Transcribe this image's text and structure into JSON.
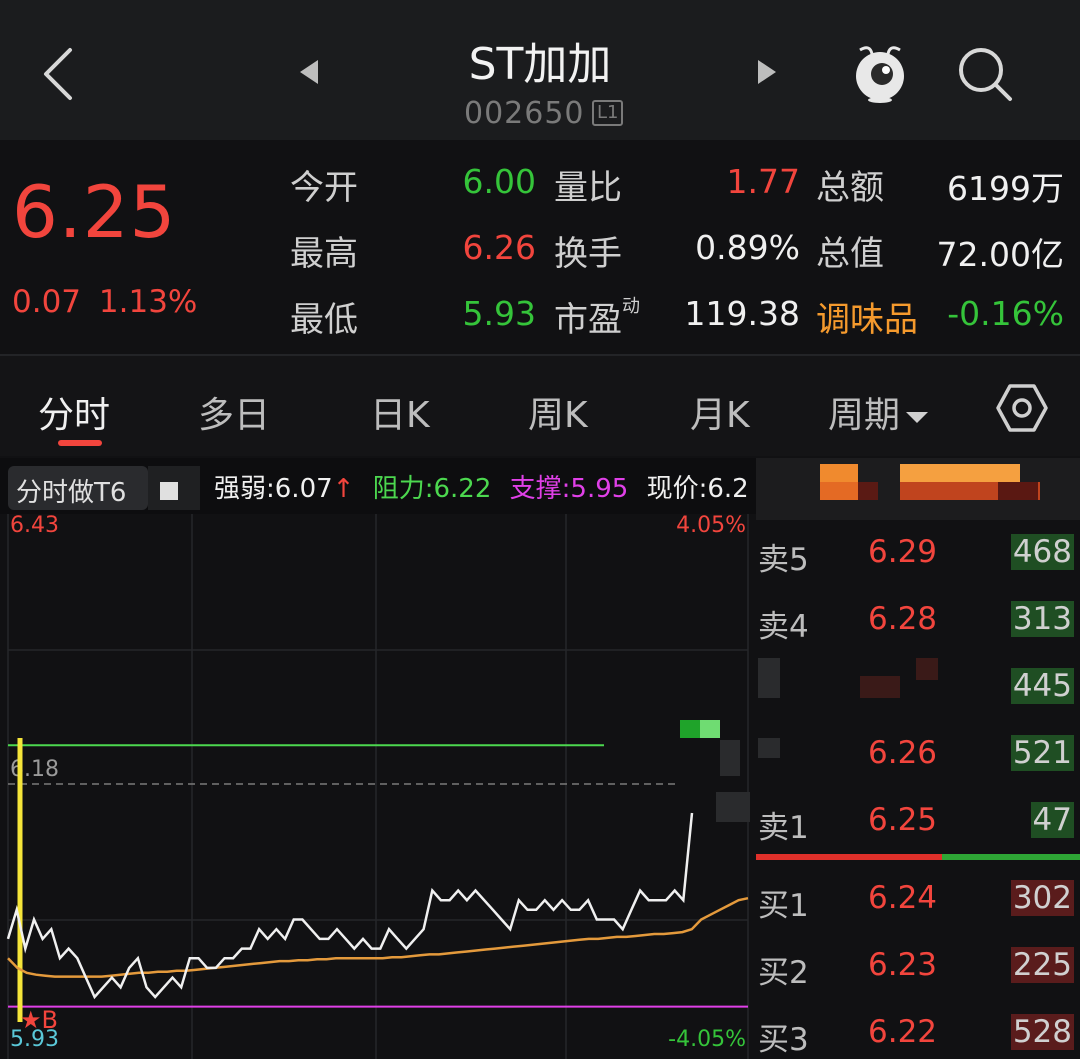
{
  "header": {
    "title": "ST加加",
    "code": "002650",
    "level_badge": "L1"
  },
  "quote": {
    "price": "6.25",
    "change": "0.07",
    "change_pct": "1.13%",
    "stats": [
      {
        "label": "今开",
        "value": "6.00",
        "color": "#35c43a"
      },
      {
        "label": "量比",
        "value": "1.77",
        "color": "#f2453d"
      },
      {
        "label": "总额",
        "value": "6199万",
        "color": "#f0f0f0"
      },
      {
        "label": "最高",
        "value": "6.26",
        "color": "#f2453d"
      },
      {
        "label": "换手",
        "value": "0.89%",
        "color": "#f0f0f0"
      },
      {
        "label": "总值",
        "value": "72.00亿",
        "color": "#f0f0f0"
      },
      {
        "label": "最低",
        "value": "5.93",
        "color": "#35c43a"
      },
      {
        "label": "市盈",
        "label_sup": "动",
        "value": "119.38",
        "color": "#f0f0f0"
      },
      {
        "label": "调味品",
        "value": "-0.16%",
        "color": "#35c43a"
      }
    ]
  },
  "tabs": [
    {
      "label": "分时",
      "active": true
    },
    {
      "label": "多日"
    },
    {
      "label": "日K"
    },
    {
      "label": "周K"
    },
    {
      "label": "月K"
    },
    {
      "label": "周期"
    }
  ],
  "indicator": {
    "tag": "分时做T6",
    "strength": "强弱:6.07",
    "strength_arrow": "↑",
    "resistance": "阻力:6.22",
    "support": "支撑:5.95",
    "current": "现价:6.2"
  },
  "chart": {
    "y_max": "6.43",
    "y_max_pct": "4.05%",
    "y_min": "5.93",
    "y_min_pct": "-4.05%",
    "prev_close": "6.18",
    "marker": "★B"
  },
  "chart_data": {
    "type": "line",
    "ylim": [
      5.93,
      6.43
    ],
    "prev_close": 6.18,
    "resistance": 6.22,
    "support": 5.95,
    "price": [
      6.02,
      6.05,
      6.01,
      6.04,
      6.02,
      6.03,
      6.0,
      6.01,
      6.0,
      5.98,
      5.96,
      5.97,
      5.98,
      5.97,
      5.99,
      6.0,
      5.97,
      5.96,
      5.97,
      5.98,
      5.97,
      6.0,
      6.0,
      5.99,
      5.99,
      6.0,
      6.0,
      6.01,
      6.01,
      6.03,
      6.02,
      6.03,
      6.02,
      6.04,
      6.04,
      6.03,
      6.02,
      6.02,
      6.03,
      6.02,
      6.01,
      6.02,
      6.01,
      6.01,
      6.03,
      6.02,
      6.01,
      6.02,
      6.03,
      6.07,
      6.06,
      6.06,
      6.07,
      6.06,
      6.07,
      6.06,
      6.05,
      6.04,
      6.03,
      6.06,
      6.05,
      6.05,
      6.06,
      6.05,
      6.06,
      6.05,
      6.05,
      6.06,
      6.04,
      6.04,
      6.04,
      6.03,
      6.05,
      6.07,
      6.06,
      6.06,
      6.06,
      6.07,
      6.06,
      6.15
    ],
    "avg": [
      6.0,
      5.99,
      5.985,
      5.983,
      5.982,
      5.981,
      5.981,
      5.981,
      5.981,
      5.981,
      5.981,
      5.982,
      5.983,
      5.984,
      5.985,
      5.985,
      5.986,
      5.986,
      5.987,
      5.987,
      5.988,
      5.989,
      5.99,
      5.991,
      5.992,
      5.993,
      5.994,
      5.995,
      5.996,
      5.997,
      5.997,
      5.998,
      5.998,
      5.999,
      5.999,
      6.0,
      6.0,
      6.0,
      6.0,
      6.0,
      6.0,
      6.001,
      6.001,
      6.002,
      6.003,
      6.004,
      6.004,
      6.005,
      6.006,
      6.007,
      6.008,
      6.009,
      6.01,
      6.011,
      6.012,
      6.013,
      6.014,
      6.015,
      6.016,
      6.017,
      6.018,
      6.019,
      6.02,
      6.02,
      6.021,
      6.022,
      6.022,
      6.023,
      6.024,
      6.025,
      6.025,
      6.026,
      6.027,
      6.03,
      6.04,
      6.045,
      6.05,
      6.055,
      6.06,
      6.062
    ]
  },
  "order_book": {
    "asks": [
      {
        "label": "卖5",
        "price": "6.29",
        "volume": "468"
      },
      {
        "label": "卖4",
        "price": "6.28",
        "volume": "313"
      },
      {
        "label": "",
        "price": "",
        "volume": "445"
      },
      {
        "label": "",
        "price": "6.26",
        "volume": "521"
      },
      {
        "label": "卖1",
        "price": "6.25",
        "volume": "47"
      }
    ],
    "bids": [
      {
        "label": "买1",
        "price": "6.24",
        "volume": "302"
      },
      {
        "label": "买2",
        "price": "6.23",
        "volume": "225"
      },
      {
        "label": "买3",
        "price": "6.22",
        "volume": "528"
      }
    ]
  }
}
